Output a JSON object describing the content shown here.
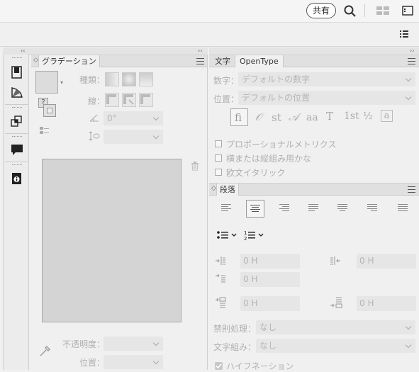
{
  "topbar": {
    "share_label": "共有"
  },
  "gradient_panel": {
    "tab_label": "グラデーション",
    "type_label": "種類：",
    "stroke_label": "線：",
    "angle_value": "0°",
    "opacity_label": "不透明度：",
    "position_label": "位置："
  },
  "char_panel": {
    "tabs": [
      "文字",
      "OpenType"
    ],
    "number_label": "数字：",
    "number_value": "デフォルトの数字",
    "position_label": "位置：",
    "position_value": "デフォルトの位置",
    "glyphs": [
      "fi",
      "𝒪",
      "st",
      "𝒜",
      "aa",
      "T",
      "1st",
      "½",
      "a"
    ],
    "checkboxes": [
      "プロポーショナルメトリクス",
      "横または縦組み用かな",
      "欧文イタリック"
    ]
  },
  "para_panel": {
    "tab_label": "段落",
    "fields": [
      "0 H",
      "0 H",
      "0 H",
      "0 H",
      "0 H"
    ],
    "kinsoku_label": "禁則処理：",
    "kinsoku_value": "なし",
    "mojikumi_label": "文字組み：",
    "mojikumi_value": "なし",
    "hyphen_label": "ハイフネーション"
  }
}
